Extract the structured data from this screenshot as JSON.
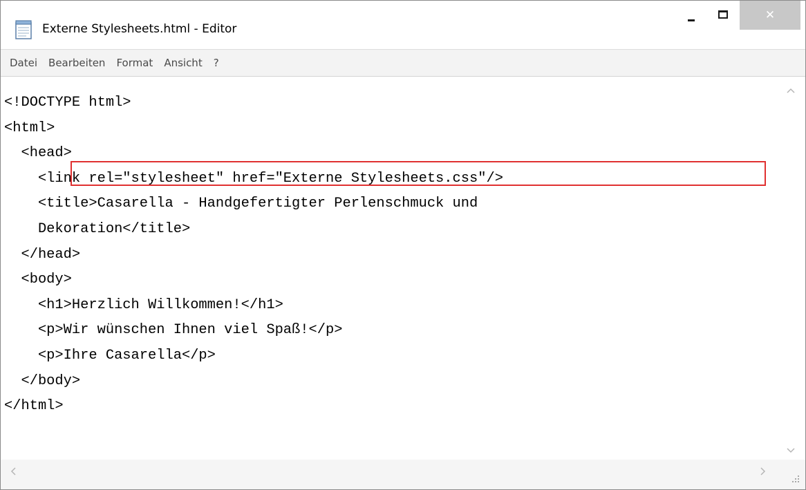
{
  "window": {
    "title": "Externe Stylesheets.html - Editor",
    "app_icon": "notepad-icon",
    "controls": {
      "minimize_icon": "minimize-icon",
      "maximize_icon": "maximize-icon",
      "close_icon": "close-icon",
      "close_glyph": "✕"
    }
  },
  "menu": {
    "items": [
      "Datei",
      "Bearbeiten",
      "Format",
      "Ansicht",
      "?"
    ]
  },
  "editor": {
    "lines": [
      "<!DOCTYPE html>",
      "<html>",
      "  <head>",
      "    <link rel=\"stylesheet\" href=\"Externe Stylesheets.css\"/>",
      "    <title>Casarella - Handgefertigter Perlenschmuck und",
      "    Dekoration</title>",
      "  </head>",
      "  <body>",
      "    <h1>Herzlich Willkommen!</h1>",
      "    <p>Wir wünschen Ihnen viel Spaß!</p>",
      "    <p>Ihre Casarella</p>",
      "  </body>",
      "</html>"
    ],
    "highlighted_line": 4,
    "highlight_color": "#e03030"
  },
  "scrollbars": {
    "up_icon": "chevron-up-icon",
    "down_icon": "chevron-down-icon",
    "left_icon": "chevron-left-icon",
    "right_icon": "chevron-right-icon",
    "grip_icon": "size-grip-icon"
  },
  "colors": {
    "close_button_bg": "#c8c8c8",
    "menubar_bg": "#f3f3f3",
    "text": "#000000"
  }
}
